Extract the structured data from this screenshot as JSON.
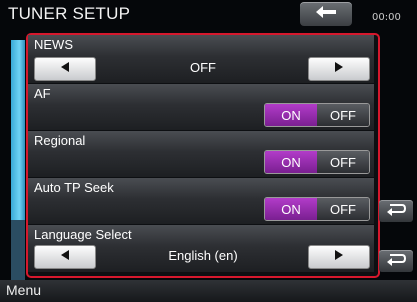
{
  "header": {
    "title": "TUNER SETUP",
    "clock": "00:00",
    "back_icon": "back-arrow-icon"
  },
  "settings": {
    "news": {
      "label": "NEWS",
      "value": "OFF"
    },
    "af": {
      "label": "AF",
      "on": "ON",
      "off": "OFF",
      "selected": "ON"
    },
    "regional": {
      "label": "Regional",
      "on": "ON",
      "off": "OFF",
      "selected": "ON"
    },
    "auto_tp_seek": {
      "label": "Auto TP Seek",
      "on": "ON",
      "off": "OFF",
      "selected": "ON"
    },
    "language_select": {
      "label": "Language Select",
      "value": "English (en)"
    }
  },
  "side": {
    "return_icon": "return-icon"
  },
  "footer": {
    "menu_label": "Menu"
  },
  "colors": {
    "frame": "#d6182d",
    "toggle_on": "#9a2fb2",
    "scrollbar": "#4fc0ea"
  }
}
